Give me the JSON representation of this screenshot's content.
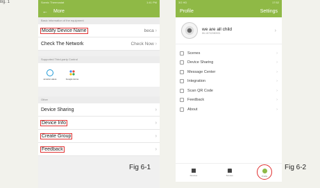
{
  "top_cut_text": "Bg. 1",
  "figure1": {
    "caption": "Fig 6-1",
    "status": {
      "left": "Scenic Thermostat",
      "right": "1:41 PM"
    },
    "title": "More",
    "section_basic": "Basic information of the equipment",
    "modify_label": "Modify Device Name",
    "modify_value": "beca",
    "network_label": "Check The Network",
    "network_value": "Check Now",
    "section_services": "Supported Third-party Control",
    "services": [
      "amazon alexa",
      "Google Home"
    ],
    "section_other": "Other",
    "items": [
      "Device Sharing",
      "Device Info",
      "Create Group",
      "Feedback"
    ]
  },
  "figure2": {
    "caption": "Fig 6-2",
    "status": {
      "left": "3G HD",
      "right": "17:52"
    },
    "title": "Profile",
    "settings": "Settings",
    "name": "we are all child",
    "user_id": "86-18702080591",
    "menu": [
      "Scenes",
      "Device Sharing",
      "Message Center",
      "Integration",
      "Scan QR Code",
      "Feedback",
      "About"
    ],
    "tabs": [
      "Devices",
      "Scenes",
      "Profile"
    ]
  },
  "colors": {
    "accent_green": "#8fb946",
    "highlight_red": "#e03030"
  },
  "icons": [
    "back-arrow-icon",
    "chevron-right-icon",
    "alexa-icon",
    "google-home-icon",
    "scenes-icon",
    "share-icon",
    "message-icon",
    "integration-icon",
    "qr-code-icon",
    "feedback-icon",
    "about-icon",
    "home-icon",
    "devices-icon",
    "profile-icon"
  ]
}
